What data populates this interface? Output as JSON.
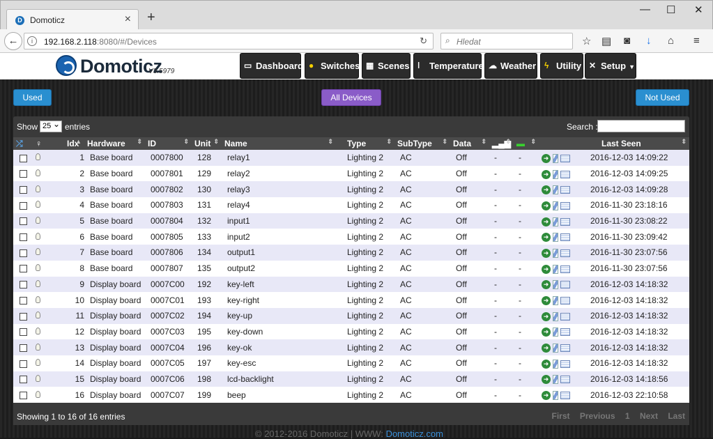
{
  "browser": {
    "tab_title": "Domoticz",
    "url_host": "192.168.2.118",
    "url_rest": ":8080/#/Devices",
    "search_placeholder": "Hledat"
  },
  "app": {
    "brand": "Domoticz",
    "version": "V3.5979",
    "nav": [
      {
        "label": "Dashboard",
        "icon": "monitor-icon"
      },
      {
        "label": "Switches",
        "icon": "bulb-icon"
      },
      {
        "label": "Scenes",
        "icon": "clapper-icon"
      },
      {
        "label": "Temperature",
        "icon": "thermometer-icon"
      },
      {
        "label": "Weather",
        "icon": "cloud-icon"
      },
      {
        "label": "Utility",
        "icon": "bolt-icon"
      },
      {
        "label": "Setup",
        "icon": "tools-icon"
      }
    ],
    "used_label": "Used",
    "all_devices_label": "All Devices",
    "not_used_label": "Not Used"
  },
  "table": {
    "show_label": "Show",
    "entries_value": "25",
    "entries_label": "entries",
    "search_label": "Search :",
    "columns": [
      "Idx",
      "Hardware",
      "ID",
      "Unit",
      "Name",
      "Type",
      "SubType",
      "Data",
      "",
      "",
      "Last Seen"
    ],
    "rows": [
      {
        "idx": "1",
        "hardware": "Base board",
        "id": "0007800",
        "unit": "128",
        "name": "relay1",
        "type": "Lighting 2",
        "subtype": "AC",
        "data": "Off",
        "sig": "-",
        "bat": "-",
        "last_seen": "2016-12-03 14:09:22"
      },
      {
        "idx": "2",
        "hardware": "Base board",
        "id": "0007801",
        "unit": "129",
        "name": "relay2",
        "type": "Lighting 2",
        "subtype": "AC",
        "data": "Off",
        "sig": "-",
        "bat": "-",
        "last_seen": "2016-12-03 14:09:25"
      },
      {
        "idx": "3",
        "hardware": "Base board",
        "id": "0007802",
        "unit": "130",
        "name": "relay3",
        "type": "Lighting 2",
        "subtype": "AC",
        "data": "Off",
        "sig": "-",
        "bat": "-",
        "last_seen": "2016-12-03 14:09:28"
      },
      {
        "idx": "4",
        "hardware": "Base board",
        "id": "0007803",
        "unit": "131",
        "name": "relay4",
        "type": "Lighting 2",
        "subtype": "AC",
        "data": "Off",
        "sig": "-",
        "bat": "-",
        "last_seen": "2016-11-30 23:18:16"
      },
      {
        "idx": "5",
        "hardware": "Base board",
        "id": "0007804",
        "unit": "132",
        "name": "input1",
        "type": "Lighting 2",
        "subtype": "AC",
        "data": "Off",
        "sig": "-",
        "bat": "-",
        "last_seen": "2016-11-30 23:08:22"
      },
      {
        "idx": "6",
        "hardware": "Base board",
        "id": "0007805",
        "unit": "133",
        "name": "input2",
        "type": "Lighting 2",
        "subtype": "AC",
        "data": "Off",
        "sig": "-",
        "bat": "-",
        "last_seen": "2016-11-30 23:09:42"
      },
      {
        "idx": "7",
        "hardware": "Base board",
        "id": "0007806",
        "unit": "134",
        "name": "output1",
        "type": "Lighting 2",
        "subtype": "AC",
        "data": "Off",
        "sig": "-",
        "bat": "-",
        "last_seen": "2016-11-30 23:07:56"
      },
      {
        "idx": "8",
        "hardware": "Base board",
        "id": "0007807",
        "unit": "135",
        "name": "output2",
        "type": "Lighting 2",
        "subtype": "AC",
        "data": "Off",
        "sig": "-",
        "bat": "-",
        "last_seen": "2016-11-30 23:07:56"
      },
      {
        "idx": "9",
        "hardware": "Display board",
        "id": "0007C00",
        "unit": "192",
        "name": "key-left",
        "type": "Lighting 2",
        "subtype": "AC",
        "data": "Off",
        "sig": "-",
        "bat": "-",
        "last_seen": "2016-12-03 14:18:32"
      },
      {
        "idx": "10",
        "hardware": "Display board",
        "id": "0007C01",
        "unit": "193",
        "name": "key-right",
        "type": "Lighting 2",
        "subtype": "AC",
        "data": "Off",
        "sig": "-",
        "bat": "-",
        "last_seen": "2016-12-03 14:18:32"
      },
      {
        "idx": "11",
        "hardware": "Display board",
        "id": "0007C02",
        "unit": "194",
        "name": "key-up",
        "type": "Lighting 2",
        "subtype": "AC",
        "data": "Off",
        "sig": "-",
        "bat": "-",
        "last_seen": "2016-12-03 14:18:32"
      },
      {
        "idx": "12",
        "hardware": "Display board",
        "id": "0007C03",
        "unit": "195",
        "name": "key-down",
        "type": "Lighting 2",
        "subtype": "AC",
        "data": "Off",
        "sig": "-",
        "bat": "-",
        "last_seen": "2016-12-03 14:18:32"
      },
      {
        "idx": "13",
        "hardware": "Display board",
        "id": "0007C04",
        "unit": "196",
        "name": "key-ok",
        "type": "Lighting 2",
        "subtype": "AC",
        "data": "Off",
        "sig": "-",
        "bat": "-",
        "last_seen": "2016-12-03 14:18:32"
      },
      {
        "idx": "14",
        "hardware": "Display board",
        "id": "0007C05",
        "unit": "197",
        "name": "key-esc",
        "type": "Lighting 2",
        "subtype": "AC",
        "data": "Off",
        "sig": "-",
        "bat": "-",
        "last_seen": "2016-12-03 14:18:32"
      },
      {
        "idx": "15",
        "hardware": "Display board",
        "id": "0007C06",
        "unit": "198",
        "name": "lcd-backlight",
        "type": "Lighting 2",
        "subtype": "AC",
        "data": "Off",
        "sig": "-",
        "bat": "-",
        "last_seen": "2016-12-03 14:18:56"
      },
      {
        "idx": "16",
        "hardware": "Display board",
        "id": "0007C07",
        "unit": "199",
        "name": "beep",
        "type": "Lighting 2",
        "subtype": "AC",
        "data": "Off",
        "sig": "-",
        "bat": "-",
        "last_seen": "2016-12-03 22:10:58"
      }
    ],
    "showing_text": "Showing 1 to 16 of 16 entries",
    "pager": [
      "First",
      "Previous",
      "1",
      "Next",
      "Last"
    ]
  },
  "footer": {
    "copyright": "© 2012-2016 Domoticz | WWW: ",
    "link": "Domoticz.com"
  },
  "colors": {
    "accent_blue": "#2a8fd0",
    "all_devices_purple": "#8a5cc8",
    "row_alt": "#e8e8f7"
  }
}
